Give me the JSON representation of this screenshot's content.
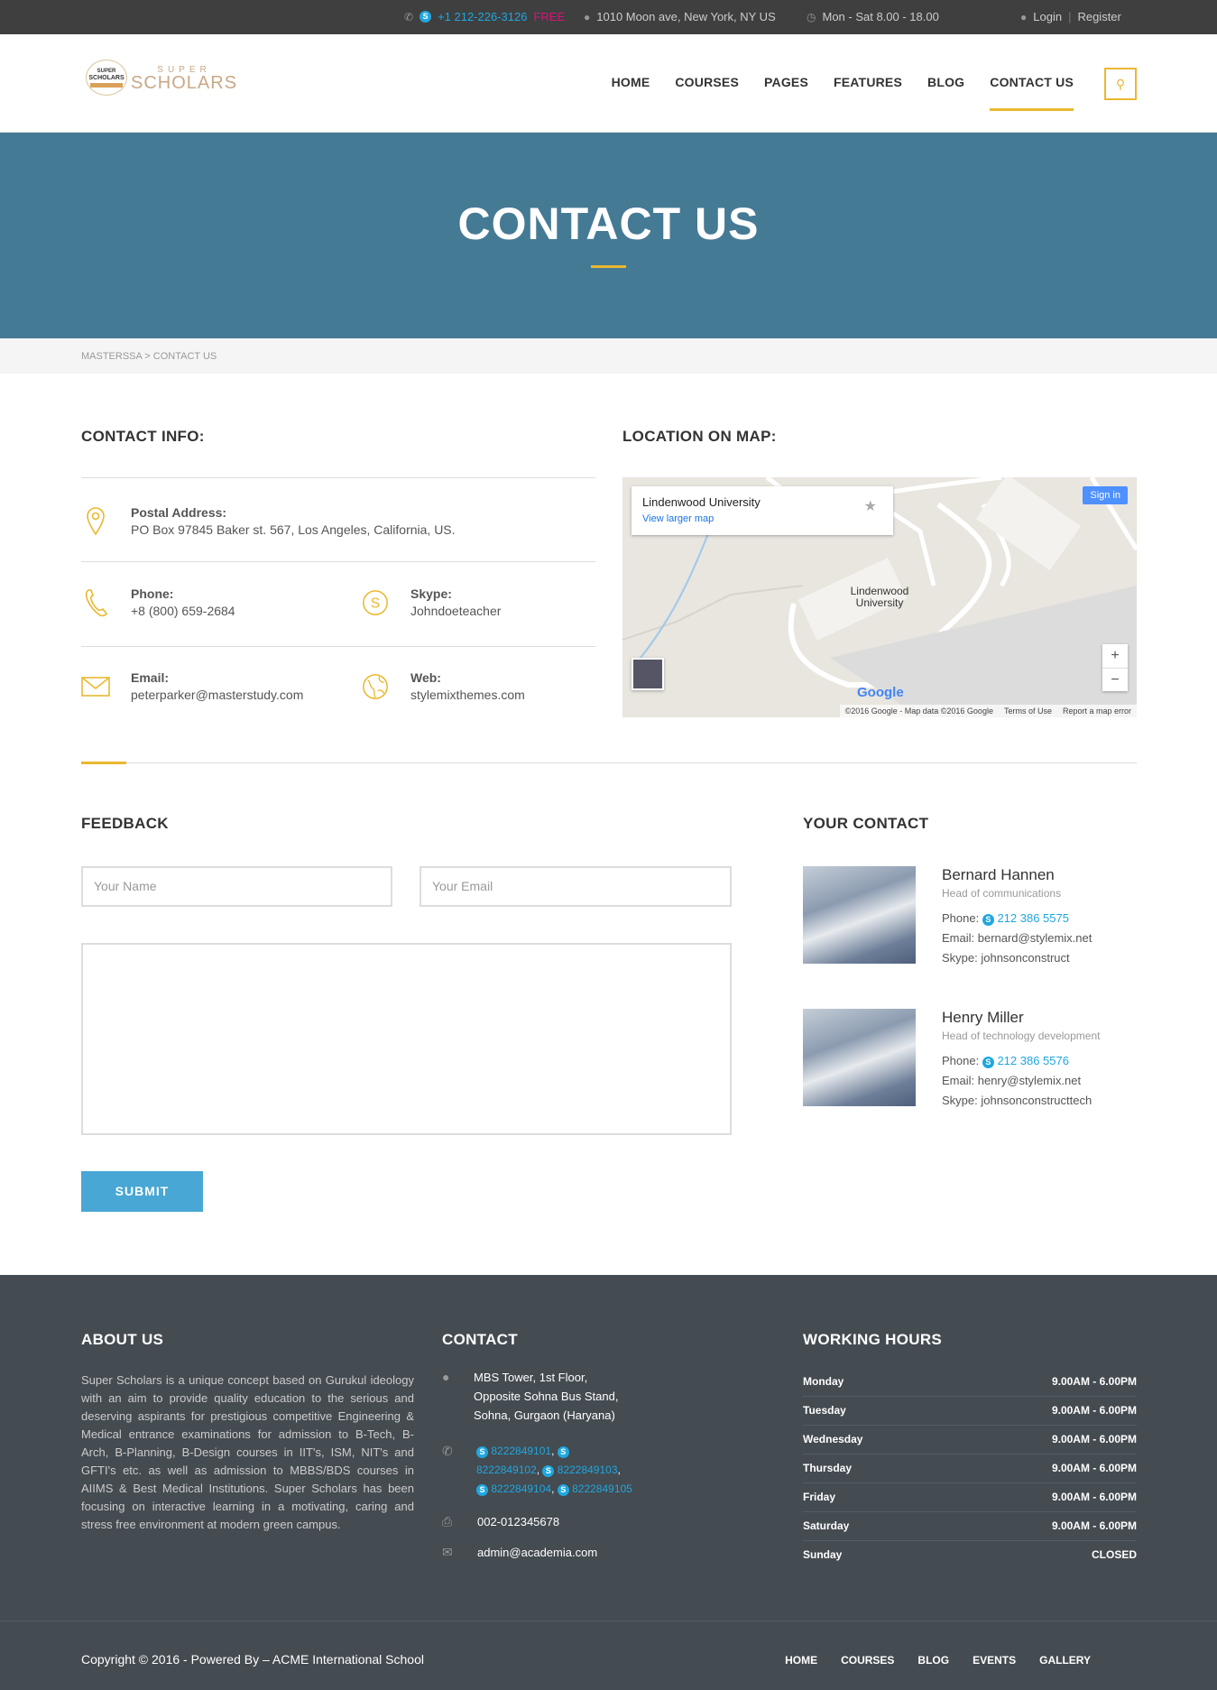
{
  "topbar": {
    "phone": "+1 212-226-3126",
    "phone_tag": "FREE",
    "address": "1010 Moon ave, New York, NY US",
    "hours": "Mon - Sat 8.00 - 18.00",
    "login": "Login",
    "register": "Register"
  },
  "logo": {
    "super": "SUPER",
    "scholars": "SCHOLARS",
    "mark_top": "SUPER",
    "mark_mid": "SCHOLARS"
  },
  "nav": [
    "HOME",
    "COURSES",
    "PAGES",
    "FEATURES",
    "BLOG",
    "CONTACT US"
  ],
  "hero": {
    "title": "CONTACT US"
  },
  "breadcrumb": "MASTERSSA > CONTACT US",
  "contact_info": {
    "title": "CONTACT INFO:",
    "postal_label": "Postal Address:",
    "postal_value": "PO Box 97845 Baker st. 567, Los Angeles, California, US.",
    "phone_label": "Phone:",
    "phone_value": "+8 (800) 659-2684",
    "skype_label": "Skype:",
    "skype_value": "Johndoeteacher",
    "email_label": "Email:",
    "email_value": "peterparker@masterstudy.com",
    "web_label": "Web:",
    "web_value": "stylemixthemes.com"
  },
  "map": {
    "title": "LOCATION ON MAP:",
    "place_name": "Lindenwood University",
    "view_larger": "View larger map",
    "sign_in": "Sign in",
    "label": "Lindenwood University",
    "google": "Google",
    "attribution": "©2016 Google - Map data ©2016 Google",
    "terms": "Terms of Use",
    "report": "Report a map error"
  },
  "feedback": {
    "title": "FEEDBACK",
    "name_placeholder": "Your Name",
    "email_placeholder": "Your Email",
    "submit": "SUBMIT"
  },
  "your_contact": {
    "title": "YOUR CONTACT",
    "people": [
      {
        "name": "Bernard Hannen",
        "role": "Head of communications",
        "phone_label": "Phone:",
        "phone": "212 386 5575",
        "email": "Email: bernard@stylemix.net",
        "skype": "Skype: johnsonconstruct"
      },
      {
        "name": "Henry Miller",
        "role": "Head of technology development",
        "phone_label": "Phone:",
        "phone": "212 386 5576",
        "email": "Email: henry@stylemix.net",
        "skype": "Skype: johnsonconstructtech"
      }
    ]
  },
  "footer": {
    "about_title": "ABOUT US",
    "about_text": "Super Scholars is a unique concept based on Gurukul ideology with an aim to provide quality education to the serious and deserving aspirants for prestigious competitive Engineering & Medical entrance examinations for admission to B-Tech, B-Arch, B-Planning, B-Design courses in IIT's, ISM, NIT's and GFTI's etc. as well as admission to MBBS/BDS courses in AIIMS & Best Medical Institutions. Super Scholars has been focusing on interactive learning in a motivating, caring and stress free environment at modern green campus.",
    "contact_title": "CONTACT",
    "address_lines": [
      "MBS Tower, 1st Floor,",
      "Opposite Sohna Bus Stand,",
      "Sohna, Gurgaon (Haryana)"
    ],
    "phones": [
      "8222849101",
      "8222849102",
      "8222849103",
      "8222849104",
      "8222849105"
    ],
    "fax": "002-012345678",
    "email": "admin@academia.com",
    "hours_title": "WORKING HOURS",
    "hours": [
      {
        "day": "Monday",
        "time": "9.00AM - 6.00PM"
      },
      {
        "day": "Tuesday",
        "time": "9.00AM - 6.00PM"
      },
      {
        "day": "Wednesday",
        "time": "9.00AM - 6.00PM"
      },
      {
        "day": "Thursday",
        "time": "9.00AM - 6.00PM"
      },
      {
        "day": "Friday",
        "time": "9.00AM - 6.00PM"
      },
      {
        "day": "Saturday",
        "time": "9.00AM - 6.00PM"
      },
      {
        "day": "Sunday",
        "time": "CLOSED"
      }
    ],
    "copyright": "Copyright © 2016 - Powered By – ACME International School",
    "nav": [
      "HOME",
      "COURSES",
      "BLOG",
      "EVENTS",
      "GALLERY"
    ]
  },
  "colors": {
    "accent": "#eab830",
    "hero": "#457a95",
    "footer": "#444b51",
    "link": "#1fa7e0",
    "submit": "#48a7d4"
  }
}
